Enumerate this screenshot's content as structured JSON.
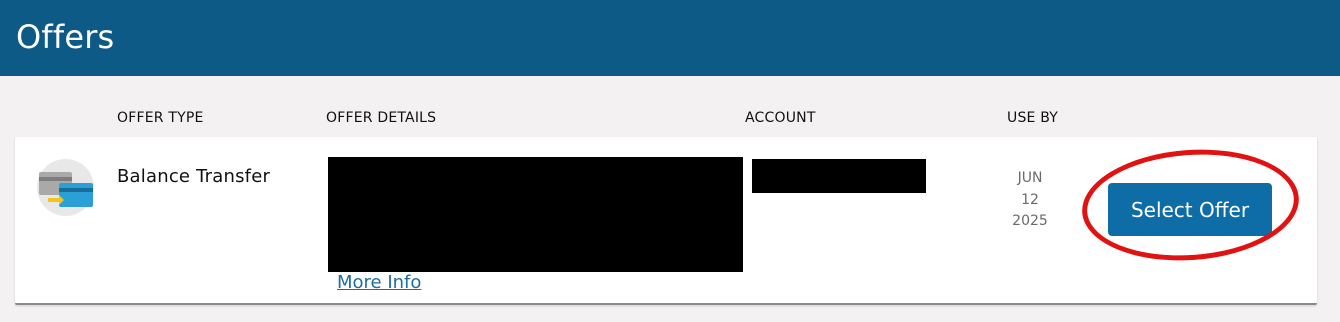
{
  "header": {
    "title": "Offers"
  },
  "columns": {
    "offer_type": "OFFER TYPE",
    "offer_details": "OFFER DETAILS",
    "account": "ACCOUNT",
    "use_by": "USE BY"
  },
  "offer": {
    "type": "Balance Transfer",
    "icon": "balance-transfer-cards-icon",
    "more_info_label": "More Info",
    "use_by": {
      "month": "JUN",
      "day": "12",
      "year": "2025"
    },
    "action_label": "Select Offer"
  },
  "colors": {
    "header_bg": "#0d5a87",
    "button_bg": "#0e6da6",
    "link": "#1a6ea1",
    "annotation": "#e01212"
  }
}
